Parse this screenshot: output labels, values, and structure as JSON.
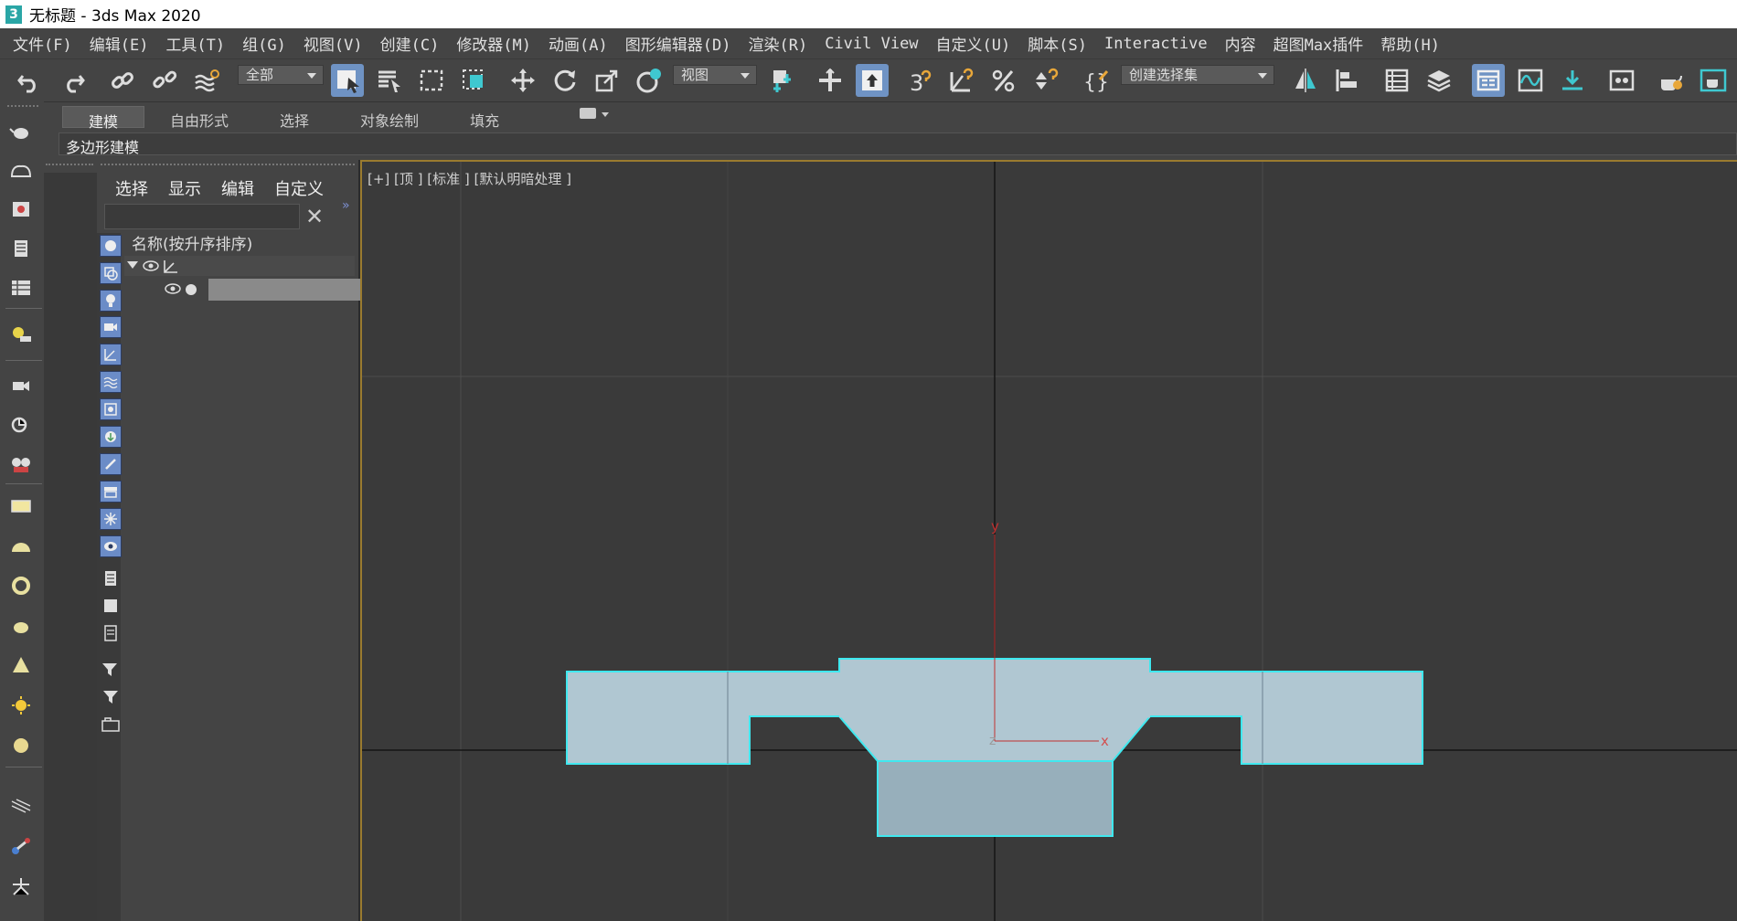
{
  "window": {
    "title": "无标题 - 3ds Max 2020",
    "icon_label": "3"
  },
  "menubar": {
    "items": [
      "文件(F)",
      "编辑(E)",
      "工具(T)",
      "组(G)",
      "视图(V)",
      "创建(C)",
      "修改器(M)",
      "动画(A)",
      "图形编辑器(D)",
      "渲染(R)",
      "Civil View",
      "自定义(U)",
      "脚本(S)",
      "Interactive",
      "内容",
      "超图Max插件",
      "帮助(H)"
    ]
  },
  "toolbar": {
    "selection_filter": "全部",
    "reference_coord": "视图",
    "named_selection": "创建选择集",
    "snap_label": "3",
    "icons": [
      "undo-icon",
      "redo-icon",
      "link-icon",
      "unlink-icon",
      "bind-spacewarp-icon",
      "select-object-icon",
      "select-by-name-icon",
      "rect-region-icon",
      "window-crossing-icon",
      "move-icon",
      "rotate-icon",
      "scale-icon",
      "place-icon",
      "pivot-icon",
      "select-manipulate-icon",
      "snap-toggle-icon",
      "angle-snap-icon",
      "percent-snap-icon",
      "spinner-snap-icon",
      "edit-named-sets-icon",
      "mirror-icon",
      "align-icon",
      "scene-explorer-icon",
      "layer-explorer-icon",
      "ribbon-toggle-icon",
      "curve-editor-icon",
      "schematic-view-icon",
      "material-editor-icon",
      "render-setup-icon",
      "render-frame-icon"
    ]
  },
  "ribbon": {
    "tabs": [
      "建模",
      "自由形式",
      "选择",
      "对象绘制",
      "填充"
    ],
    "active_tab": "建模",
    "panel_label": "多边形建模"
  },
  "scene_explorer": {
    "menus": [
      "选择",
      "显示",
      "编辑",
      "自定义"
    ],
    "column_header": "名称(按升序排序)",
    "search_placeholder": "",
    "close_glyph": "✕",
    "more_glyph": "»"
  },
  "viewport": {
    "label": "[+] [顶 ] [标准 ] [默认明暗处理 ]",
    "axis_labels": {
      "y": "y",
      "x": "x",
      "z": "z"
    },
    "shape_color": "#b5ccd6",
    "shape_outline": "#3fe8ef",
    "grid_color": "#4c4c4c",
    "axis_line_color": "#151515"
  }
}
